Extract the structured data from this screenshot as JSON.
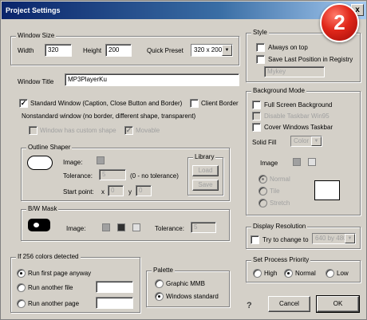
{
  "window": {
    "title": "Project Settings",
    "close_glyph": "x"
  },
  "badge": {
    "number": "2",
    "color": "#e0271a"
  },
  "window_size": {
    "legend": "Window Size",
    "width_label": "Width",
    "width_value": "320",
    "height_label": "Height",
    "height_value": "200",
    "preset_label": "Quick Preset",
    "preset_value": "320 x 200"
  },
  "window_title": {
    "label": "Window Title",
    "value": "MP3PlayerKu"
  },
  "style": {
    "legend": "Style",
    "always_on_top": "Always on top",
    "save_position": "Save Last Position in Registry",
    "registry_key": "Mykey"
  },
  "standard_window": {
    "label": "Standard Window (Caption, Close Button and Border)",
    "client_border": "Client Border",
    "nonstandard": "Nonstandard window (no border, different shape, transparent)",
    "custom_shape": "Window has custom shape",
    "movable": "Movable"
  },
  "outline_shaper": {
    "legend": "Outline Shaper",
    "image_label": "Image:",
    "tolerance_label": "Tolerance:",
    "tolerance_value": "5",
    "tolerance_note": "(0 - no tolerance)",
    "start_label": "Start point:",
    "x_label": "x",
    "x_value": "0",
    "y_label": "y",
    "y_value": "0",
    "library_label": "Library",
    "load_button": "Load",
    "save_button": "Save"
  },
  "bw_mask": {
    "legend": "B/W Mask",
    "image_label": "Image:",
    "tolerance_label": "Tolerance:",
    "tolerance_value": "5"
  },
  "background_mode": {
    "legend": "Background Mode",
    "full_screen": "Full Screen Background",
    "disable_taskbar": "Disable Taskbar Win95",
    "cover_taskbar": "Cover Windows Taskbar",
    "solid_fill_label": "Solid Fill",
    "solid_fill_value": "Color",
    "image_label": "Image",
    "normal": "Normal",
    "tile": "Tile",
    "stretch": "Stretch"
  },
  "display_resolution": {
    "legend": "Display Resolution",
    "try_label": "Try to change to",
    "value": "640 by 480"
  },
  "colors_256": {
    "legend": "If 256 colors detected",
    "run_first": "Run first page anyway",
    "run_file": "Run another file",
    "run_page": "Run another page"
  },
  "palette": {
    "legend": "Palette",
    "graphic_mmb": "Graphic MMB",
    "windows_standard": "Windows standard"
  },
  "priority": {
    "legend": "Set Process Priority",
    "high": "High",
    "normal": "Normal",
    "low": "Low"
  },
  "footer": {
    "help_glyph": "?",
    "cancel": "Cancel",
    "ok": "OK"
  }
}
